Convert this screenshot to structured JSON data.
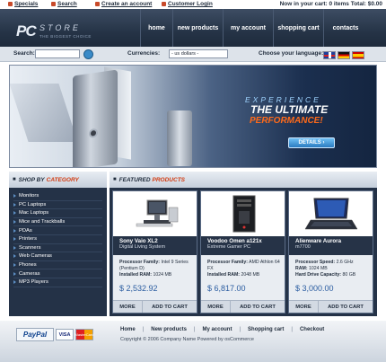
{
  "topbar": {
    "specials": "Specials",
    "search": "Search",
    "create_account": "Create an account",
    "customer_login": "Customer Login",
    "cart_status": "Now in your cart: 0 items Total: $0.00"
  },
  "header": {
    "logo_pc": "PC",
    "logo_store": "STORE",
    "logo_tagline": "THE BIGGEST CHOICE",
    "nav": [
      "home",
      "new products",
      "my account",
      "shopping cart",
      "contacts"
    ]
  },
  "searchbar": {
    "search_label": "Search:",
    "search_value": "",
    "currencies_label": "Currencies:",
    "currency_selected": "- us dollars -",
    "language_label": "Choose your language:"
  },
  "banner": {
    "line1": "EXPERIENCE",
    "line2": "THE ULTIMATE",
    "line3": "PERFORMANCE!",
    "details": "DETAILS"
  },
  "sidebar": {
    "title_a": "SHOP BY",
    "title_b": "CATEGORY",
    "categories": [
      "Monitors",
      "PC Laptops",
      "Mac Laptops",
      "Mice and Trackballs",
      "PDAs",
      "Printers",
      "Scanners",
      "Web Cameras",
      "Phones",
      "Cameras",
      "MP3 Players"
    ]
  },
  "featured": {
    "title_a": "FEATURED",
    "title_b": "PRODUCTS",
    "more_label": "MORE",
    "add_label": "ADD TO CART",
    "products": [
      {
        "name": "Sony Vaio XL2",
        "sub": "Digital Living System",
        "spec1_label": "Processor Family:",
        "spec1_value": "Intel 9 Series (Pentium D)",
        "spec2_label": "Installed RAM:",
        "spec2_value": "1024 MB",
        "price": "$ 2,532.92"
      },
      {
        "name": "Voodoo Omen a121x",
        "sub": "Extreme Gamer PC",
        "spec1_label": "Processor Family:",
        "spec1_value": "AMD Athlon 64 FX",
        "spec2_label": "Installed RAM:",
        "spec2_value": "2048 MB",
        "price": "$ 6,817.00"
      },
      {
        "name": "Alienware Aurora",
        "sub": "m7700",
        "spec1_label": "Processor Speed:",
        "spec1_value": "2.6 GHz",
        "spec2_label": "RAM:",
        "spec2_value": "1024 MB",
        "spec3_label": "Hard Drive Capacity:",
        "spec3_value": "80 GB",
        "price": "$ 3,000.00"
      }
    ]
  },
  "footer": {
    "paypal": "PayPal",
    "visa": "VISA",
    "mastercard": "MasterCard",
    "links": [
      "Home",
      "New products",
      "My account",
      "Shopping cart",
      "Checkout"
    ],
    "copyright": "Copyright © 2006 Company Name Powered by osCommerce"
  }
}
